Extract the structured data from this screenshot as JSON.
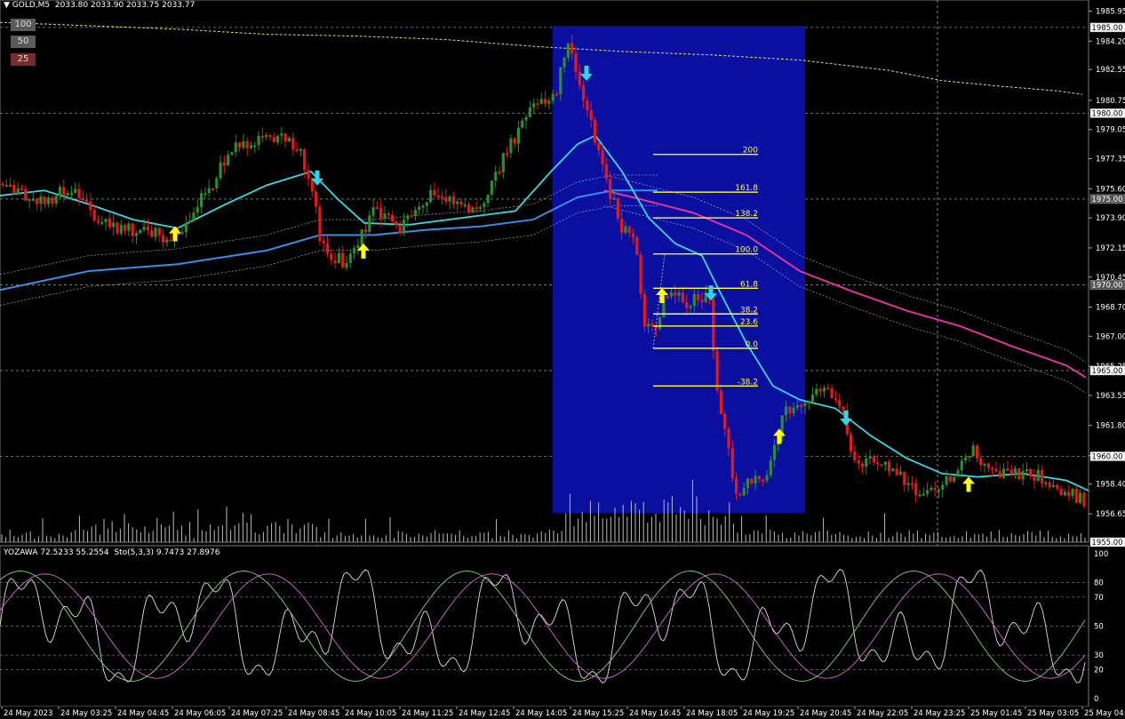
{
  "header": {
    "triangle": "▼",
    "symbol": "GOLD,M5",
    "ohlc": "2033.80 2033.90 2033.75 2033.77"
  },
  "buttons": [
    {
      "label": "100",
      "bg": "#5a5a5a"
    },
    {
      "label": "50",
      "bg": "#5a5a5a"
    },
    {
      "label": "25",
      "bg": "#7a2b2b"
    }
  ],
  "subwindow": {
    "title": "YOZAWA 72.5233 55.2554  Sto(5,3,3) 9.7473 27.8976",
    "scale_labels": [
      "100",
      "80",
      "70",
      "50",
      "30",
      "20",
      "0"
    ]
  },
  "colors": {
    "bull": "#2e8b2e",
    "bear": "#e41a1a",
    "ma_fast": "#38d9e6",
    "ma_slow": "#3a8de8",
    "ma_pink": "#e6329b",
    "highlight": "#0a0fa0",
    "fib": "#ffff33",
    "arrow_up": "#ffff00",
    "arrow_down": "#2fd6e8"
  },
  "chart_data": {
    "type": "candlestick",
    "y_ticks": [
      "1985.95",
      "1984.20",
      "1982.55",
      "1980.75",
      "1979.05",
      "1977.35",
      "1975.60",
      "1973.90",
      "1972.15",
      "1970.45",
      "1968.70",
      "1967.00",
      "1965.25",
      "1963.55",
      "1961.80",
      "1960.05",
      "1958.40",
      "1956.65",
      "1955.00"
    ],
    "y_range": [
      1955.0,
      1986.6
    ],
    "price_boxes": [
      {
        "label": "1985.00",
        "value": 1985.0,
        "dark": false
      },
      {
        "label": "1980.00",
        "value": 1980.0,
        "dark": false
      },
      {
        "label": "1975.00",
        "value": 1975.0,
        "dark": true
      },
      {
        "label": "1970.00",
        "value": 1970.0,
        "dark": true
      },
      {
        "label": "1965.00",
        "value": 1965.0,
        "dark": false
      },
      {
        "label": "1960.00",
        "value": 1960.0,
        "dark": false
      },
      {
        "label": "1955.00",
        "value": 1955.0,
        "dark": false
      }
    ],
    "hlines": [
      1985.0,
      1980.0,
      1975.0,
      1970.0,
      1965.0,
      1960.0
    ],
    "x_ticks": [
      "24 May 2023",
      "24 May 03:25",
      "24 May 04:45",
      "24 May 06:05",
      "24 May 07:25",
      "24 May 08:45",
      "24 May 10:05",
      "24 May 11:25",
      "24 May 12:45",
      "24 May 14:05",
      "24 May 15:25",
      "24 May 16:45",
      "24 May 18:05",
      "24 May 19:25",
      "24 May 20:45",
      "24 May 22:05",
      "24 May 23:25",
      "25 May 01:45",
      "25 May 03:05",
      "25 May 04:"
    ],
    "fib_levels": [
      {
        "label": "200",
        "price": 1977.6
      },
      {
        "label": "161.8",
        "price": 1975.4
      },
      {
        "label": "138.2",
        "price": 1973.9
      },
      {
        "label": "100.0",
        "price": 1971.8
      },
      {
        "label": "61.8",
        "price": 1969.8
      },
      {
        "label": "38.2",
        "price": 1968.3
      },
      {
        "label": "23.6",
        "price": 1967.6
      },
      {
        "label": "0.0",
        "price": 1966.3
      },
      {
        "label": "-38.2",
        "price": 1964.1
      }
    ],
    "path": [
      [
        0,
        1975.9
      ],
      [
        20,
        1975.5
      ],
      [
        40,
        1974.8
      ],
      [
        60,
        1975.1
      ],
      [
        80,
        1975.7
      ],
      [
        100,
        1974.4
      ],
      [
        120,
        1973.5
      ],
      [
        150,
        1973.2
      ],
      [
        175,
        1973.0
      ],
      [
        195,
        1972.6
      ],
      [
        205,
        1973.4
      ],
      [
        230,
        1975.2
      ],
      [
        260,
        1977.8
      ],
      [
        290,
        1978.4
      ],
      [
        320,
        1978.6
      ],
      [
        335,
        1978.0
      ],
      [
        350,
        1976.2
      ],
      [
        360,
        1972.9
      ],
      [
        375,
        1971.6
      ],
      [
        390,
        1971.3
      ],
      [
        405,
        1972.6
      ],
      [
        420,
        1974.4
      ],
      [
        450,
        1973.3
      ],
      [
        480,
        1975.2
      ],
      [
        510,
        1974.8
      ],
      [
        540,
        1974.5
      ],
      [
        570,
        1977.7
      ],
      [
        600,
        1980.5
      ],
      [
        625,
        1981.2
      ],
      [
        640,
        1984.0
      ],
      [
        655,
        1981.5
      ],
      [
        665,
        1979.3
      ],
      [
        680,
        1976.4
      ],
      [
        700,
        1973.3
      ],
      [
        715,
        1972.3
      ],
      [
        725,
        1967.7
      ],
      [
        740,
        1967.8
      ],
      [
        750,
        1969.6
      ],
      [
        770,
        1969.0
      ],
      [
        800,
        1969.5
      ],
      [
        805,
        1964.2
      ],
      [
        815,
        1961.4
      ],
      [
        830,
        1957.5
      ],
      [
        845,
        1958.6
      ],
      [
        865,
        1959.1
      ],
      [
        880,
        1962.3
      ],
      [
        900,
        1963.3
      ],
      [
        915,
        1963.7
      ],
      [
        930,
        1963.8
      ],
      [
        950,
        1962.5
      ],
      [
        960,
        1959.5
      ],
      [
        980,
        1960.0
      ],
      [
        1000,
        1959.5
      ],
      [
        1020,
        1958.4
      ],
      [
        1040,
        1957.5
      ],
      [
        1060,
        1958.3
      ],
      [
        1080,
        1959.6
      ],
      [
        1095,
        1960.3
      ],
      [
        1110,
        1959.2
      ],
      [
        1140,
        1959.0
      ],
      [
        1170,
        1958.8
      ],
      [
        1200,
        1957.9
      ],
      [
        1220,
        1957.4
      ]
    ],
    "ma_fast": [
      [
        0,
        1975.2
      ],
      [
        50,
        1975.5
      ],
      [
        100,
        1974.7
      ],
      [
        150,
        1973.8
      ],
      [
        200,
        1973.3
      ],
      [
        250,
        1974.6
      ],
      [
        300,
        1975.8
      ],
      [
        350,
        1976.6
      ],
      [
        380,
        1975.0
      ],
      [
        410,
        1973.6
      ],
      [
        460,
        1973.5
      ],
      [
        520,
        1973.9
      ],
      [
        580,
        1974.3
      ],
      [
        620,
        1976.6
      ],
      [
        650,
        1978.2
      ],
      [
        670,
        1978.7
      ],
      [
        700,
        1976.6
      ],
      [
        730,
        1973.9
      ],
      [
        760,
        1972.4
      ],
      [
        790,
        1971.7
      ],
      [
        810,
        1969.6
      ],
      [
        840,
        1966.6
      ],
      [
        870,
        1964.1
      ],
      [
        900,
        1963.3
      ],
      [
        940,
        1962.8
      ],
      [
        980,
        1961.2
      ],
      [
        1020,
        1959.9
      ],
      [
        1060,
        1959.0
      ],
      [
        1100,
        1958.8
      ],
      [
        1150,
        1959.0
      ],
      [
        1200,
        1958.6
      ],
      [
        1225,
        1958.0
      ]
    ],
    "ma_slow": [
      [
        0,
        1969.7
      ],
      [
        100,
        1970.8
      ],
      [
        200,
        1971.2
      ],
      [
        300,
        1972.0
      ],
      [
        360,
        1972.9
      ],
      [
        420,
        1972.9
      ],
      [
        480,
        1973.2
      ],
      [
        540,
        1973.4
      ],
      [
        600,
        1973.8
      ],
      [
        650,
        1975.1
      ],
      [
        690,
        1975.5
      ],
      [
        740,
        1975.5
      ]
    ],
    "ma_pink": [
      [
        680,
        1975.5
      ],
      [
        720,
        1975.0
      ],
      [
        780,
        1974.2
      ],
      [
        840,
        1972.9
      ],
      [
        900,
        1970.8
      ],
      [
        960,
        1969.6
      ],
      [
        1020,
        1968.5
      ],
      [
        1080,
        1967.6
      ],
      [
        1140,
        1966.4
      ],
      [
        1200,
        1965.3
      ],
      [
        1222,
        1964.6
      ]
    ],
    "ma_yellow": [
      [
        0,
        1985.3
      ],
      [
        100,
        1985.1
      ],
      [
        200,
        1984.9
      ],
      [
        300,
        1984.6
      ],
      [
        400,
        1984.5
      ],
      [
        500,
        1984.3
      ],
      [
        600,
        1983.9
      ],
      [
        700,
        1983.6
      ],
      [
        800,
        1983.4
      ],
      [
        900,
        1983.1
      ],
      [
        1000,
        1982.5
      ],
      [
        1060,
        1981.9
      ],
      [
        1120,
        1981.6
      ],
      [
        1190,
        1981.3
      ],
      [
        1218,
        1981.1
      ]
    ],
    "arrows": [
      {
        "x": 197,
        "price": 1973.0,
        "dir": "up"
      },
      {
        "x": 409,
        "price": 1972.0,
        "dir": "up"
      },
      {
        "x": 745,
        "price": 1969.4,
        "dir": "up"
      },
      {
        "x": 877,
        "price": 1961.2,
        "dir": "up"
      },
      {
        "x": 1090,
        "price": 1958.4,
        "dir": "up"
      },
      {
        "x": 357,
        "price": 1976.2,
        "dir": "down"
      },
      {
        "x": 660,
        "price": 1982.3,
        "dir": "down"
      },
      {
        "x": 800,
        "price": 1969.5,
        "dir": "down"
      },
      {
        "x": 952,
        "price": 1962.2,
        "dir": "down"
      }
    ]
  }
}
